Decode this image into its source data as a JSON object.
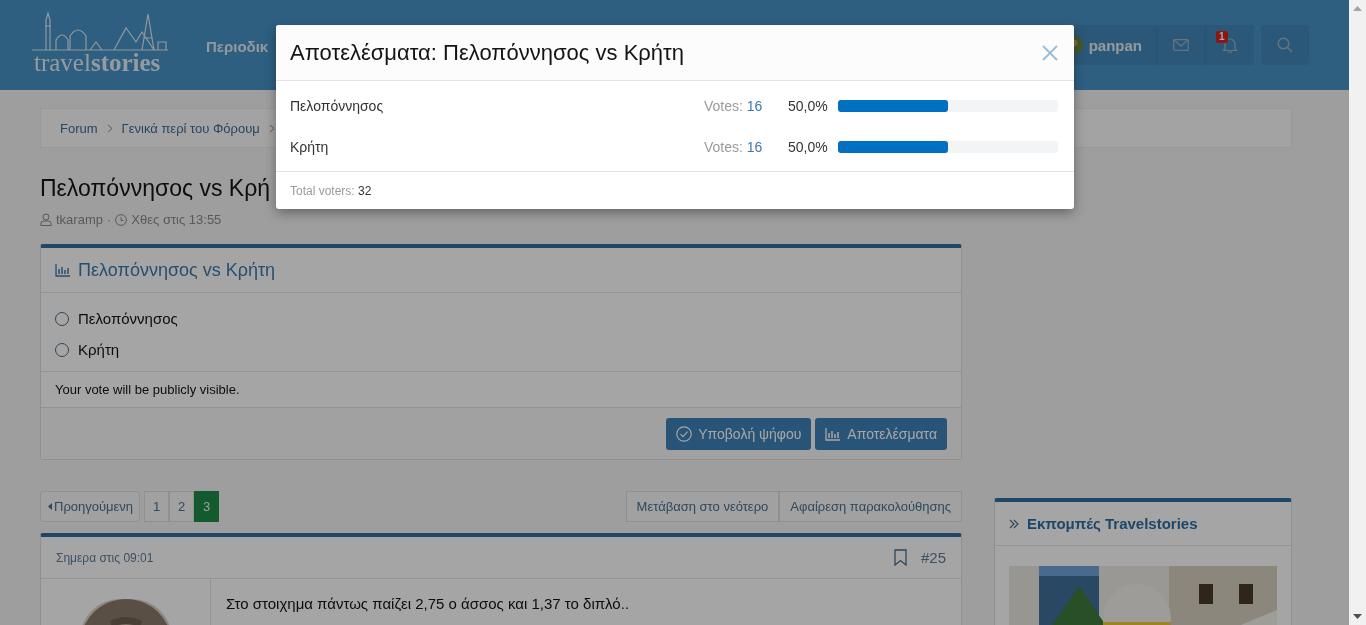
{
  "header": {
    "logo": "travel**stories**",
    "nav_item": "Περιοδικ",
    "user": {
      "name": "panpan"
    },
    "notifications": {
      "badge": "1"
    }
  },
  "breadcrumb": [
    "Forum",
    "Γενικά περί του Φόρουμ"
  ],
  "thread": {
    "title": "Πελοπόννησος vs Κρή",
    "author": "tkaramp",
    "separator": "·",
    "time": "Χθες στις 13:55"
  },
  "poll": {
    "title": "Πελοπόννησος vs Κρήτη",
    "options": [
      {
        "label": "Πελοπόννησος",
        "selected": false
      },
      {
        "label": "Κρήτη",
        "selected": false
      }
    ],
    "note": "Your vote will be publicly visible.",
    "buttons": [
      {
        "kind": "vote",
        "label": "Υποβολή ψήφου"
      },
      {
        "kind": "results",
        "label": "Αποτελέσματα"
      }
    ]
  },
  "pagination": {
    "prev": "Προηγούμενη",
    "pages": [
      {
        "label": "1",
        "selected": false
      },
      {
        "label": "2",
        "selected": false
      },
      {
        "label": "3",
        "selected": true
      }
    ]
  },
  "thread_actions": [
    "Μετάβαση στο νεότερο",
    "Αφαίρεση παρακολούθησης"
  ],
  "post": {
    "time": "Σημερα στις 09:01",
    "number": "#25",
    "text": "Στο στοιχημα πάντως παίζει 2,75 ο άσσος και 1,37 το διπλό.."
  },
  "sidebar_widget": {
    "title": "Εκπομπές Travelstories"
  },
  "modal": {
    "title": "Αποτελέσματα: Πελοπόννησος vs Κρήτη",
    "results": [
      {
        "option": "Πελοπόννησος",
        "votes_label": "Votes:",
        "votes": "16",
        "percent": "50,0%",
        "level": 0.5
      },
      {
        "option": "Κρήτη",
        "votes_label": "Votes:",
        "votes": "16",
        "percent": "50,0%",
        "level": 0.5
      }
    ],
    "total_label": "Total voters:",
    "total": "32"
  }
}
